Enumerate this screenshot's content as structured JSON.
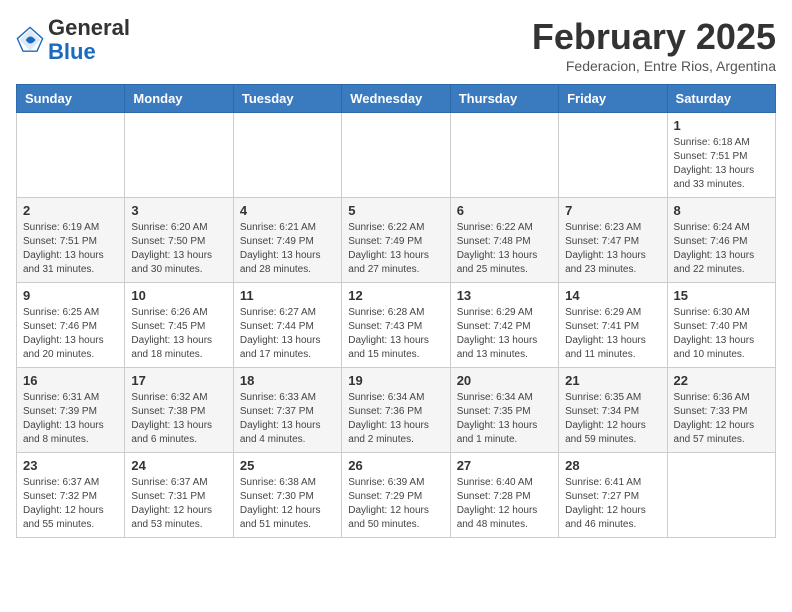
{
  "logo": {
    "general": "General",
    "blue": "Blue"
  },
  "header": {
    "month": "February 2025",
    "location": "Federacion, Entre Rios, Argentina"
  },
  "weekdays": [
    "Sunday",
    "Monday",
    "Tuesday",
    "Wednesday",
    "Thursday",
    "Friday",
    "Saturday"
  ],
  "weeks": [
    [
      {
        "day": "",
        "info": ""
      },
      {
        "day": "",
        "info": ""
      },
      {
        "day": "",
        "info": ""
      },
      {
        "day": "",
        "info": ""
      },
      {
        "day": "",
        "info": ""
      },
      {
        "day": "",
        "info": ""
      },
      {
        "day": "1",
        "info": "Sunrise: 6:18 AM\nSunset: 7:51 PM\nDaylight: 13 hours and 33 minutes."
      }
    ],
    [
      {
        "day": "2",
        "info": "Sunrise: 6:19 AM\nSunset: 7:51 PM\nDaylight: 13 hours and 31 minutes."
      },
      {
        "day": "3",
        "info": "Sunrise: 6:20 AM\nSunset: 7:50 PM\nDaylight: 13 hours and 30 minutes."
      },
      {
        "day": "4",
        "info": "Sunrise: 6:21 AM\nSunset: 7:49 PM\nDaylight: 13 hours and 28 minutes."
      },
      {
        "day": "5",
        "info": "Sunrise: 6:22 AM\nSunset: 7:49 PM\nDaylight: 13 hours and 27 minutes."
      },
      {
        "day": "6",
        "info": "Sunrise: 6:22 AM\nSunset: 7:48 PM\nDaylight: 13 hours and 25 minutes."
      },
      {
        "day": "7",
        "info": "Sunrise: 6:23 AM\nSunset: 7:47 PM\nDaylight: 13 hours and 23 minutes."
      },
      {
        "day": "8",
        "info": "Sunrise: 6:24 AM\nSunset: 7:46 PM\nDaylight: 13 hours and 22 minutes."
      }
    ],
    [
      {
        "day": "9",
        "info": "Sunrise: 6:25 AM\nSunset: 7:46 PM\nDaylight: 13 hours and 20 minutes."
      },
      {
        "day": "10",
        "info": "Sunrise: 6:26 AM\nSunset: 7:45 PM\nDaylight: 13 hours and 18 minutes."
      },
      {
        "day": "11",
        "info": "Sunrise: 6:27 AM\nSunset: 7:44 PM\nDaylight: 13 hours and 17 minutes."
      },
      {
        "day": "12",
        "info": "Sunrise: 6:28 AM\nSunset: 7:43 PM\nDaylight: 13 hours and 15 minutes."
      },
      {
        "day": "13",
        "info": "Sunrise: 6:29 AM\nSunset: 7:42 PM\nDaylight: 13 hours and 13 minutes."
      },
      {
        "day": "14",
        "info": "Sunrise: 6:29 AM\nSunset: 7:41 PM\nDaylight: 13 hours and 11 minutes."
      },
      {
        "day": "15",
        "info": "Sunrise: 6:30 AM\nSunset: 7:40 PM\nDaylight: 13 hours and 10 minutes."
      }
    ],
    [
      {
        "day": "16",
        "info": "Sunrise: 6:31 AM\nSunset: 7:39 PM\nDaylight: 13 hours and 8 minutes."
      },
      {
        "day": "17",
        "info": "Sunrise: 6:32 AM\nSunset: 7:38 PM\nDaylight: 13 hours and 6 minutes."
      },
      {
        "day": "18",
        "info": "Sunrise: 6:33 AM\nSunset: 7:37 PM\nDaylight: 13 hours and 4 minutes."
      },
      {
        "day": "19",
        "info": "Sunrise: 6:34 AM\nSunset: 7:36 PM\nDaylight: 13 hours and 2 minutes."
      },
      {
        "day": "20",
        "info": "Sunrise: 6:34 AM\nSunset: 7:35 PM\nDaylight: 13 hours and 1 minute."
      },
      {
        "day": "21",
        "info": "Sunrise: 6:35 AM\nSunset: 7:34 PM\nDaylight: 12 hours and 59 minutes."
      },
      {
        "day": "22",
        "info": "Sunrise: 6:36 AM\nSunset: 7:33 PM\nDaylight: 12 hours and 57 minutes."
      }
    ],
    [
      {
        "day": "23",
        "info": "Sunrise: 6:37 AM\nSunset: 7:32 PM\nDaylight: 12 hours and 55 minutes."
      },
      {
        "day": "24",
        "info": "Sunrise: 6:37 AM\nSunset: 7:31 PM\nDaylight: 12 hours and 53 minutes."
      },
      {
        "day": "25",
        "info": "Sunrise: 6:38 AM\nSunset: 7:30 PM\nDaylight: 12 hours and 51 minutes."
      },
      {
        "day": "26",
        "info": "Sunrise: 6:39 AM\nSunset: 7:29 PM\nDaylight: 12 hours and 50 minutes."
      },
      {
        "day": "27",
        "info": "Sunrise: 6:40 AM\nSunset: 7:28 PM\nDaylight: 12 hours and 48 minutes."
      },
      {
        "day": "28",
        "info": "Sunrise: 6:41 AM\nSunset: 7:27 PM\nDaylight: 12 hours and 46 minutes."
      },
      {
        "day": "",
        "info": ""
      }
    ]
  ]
}
